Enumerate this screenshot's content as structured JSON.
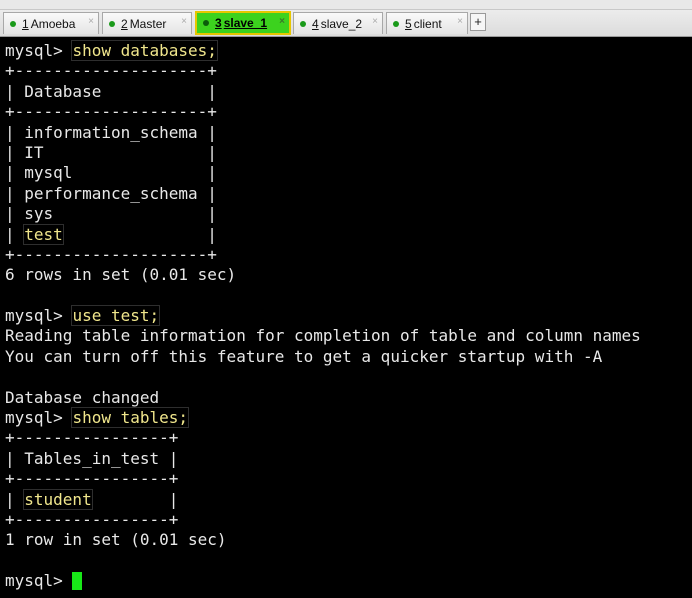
{
  "tabs": [
    {
      "num": "1",
      "label": "Amoeba",
      "active": false
    },
    {
      "num": "2",
      "label": "Master",
      "active": false
    },
    {
      "num": "3",
      "label": "slave_1",
      "active": true
    },
    {
      "num": "4",
      "label": "slave_2",
      "active": false
    },
    {
      "num": "5",
      "label": "client",
      "active": false
    }
  ],
  "tab_close_glyph": "×",
  "new_tab_glyph": "+",
  "terminal": {
    "prompt": "mysql> ",
    "lines": [
      {
        "prefix": "mysql> ",
        "cmd": "show databases;"
      },
      {
        "text": "+--------------------+"
      },
      {
        "text": "| Database           |"
      },
      {
        "text": "+--------------------+"
      },
      {
        "text": "| information_schema |"
      },
      {
        "text": "| IT                 |"
      },
      {
        "text": "| mysql              |"
      },
      {
        "text": "| performance_schema |"
      },
      {
        "text": "| sys                |"
      },
      {
        "prefix": "| ",
        "cmd": "test",
        "suffix": "               |"
      },
      {
        "text": "+--------------------+"
      },
      {
        "text": "6 rows in set (0.01 sec)"
      },
      {
        "text": ""
      },
      {
        "prefix": "mysql> ",
        "cmd": "use test;"
      },
      {
        "text": "Reading table information for completion of table and column names"
      },
      {
        "text": "You can turn off this feature to get a quicker startup with -A"
      },
      {
        "text": ""
      },
      {
        "text": "Database changed"
      },
      {
        "prefix": "mysql> ",
        "cmd": "show tables;"
      },
      {
        "text": "+----------------+"
      },
      {
        "text": "| Tables_in_test |"
      },
      {
        "text": "+----------------+"
      },
      {
        "prefix": "| ",
        "cmd": "student",
        "suffix": "        |"
      },
      {
        "text": "+----------------+"
      },
      {
        "text": "1 row in set (0.01 sec)"
      },
      {
        "text": ""
      },
      {
        "prefix": "mysql> ",
        "cursor": true
      }
    ]
  },
  "colors": {
    "background": "#000000",
    "text": "#e8e8e8",
    "command": "#f0e68c",
    "cursor": "#18e818",
    "active_tab": "#3cd21e",
    "active_tab_border": "#e6c600"
  }
}
